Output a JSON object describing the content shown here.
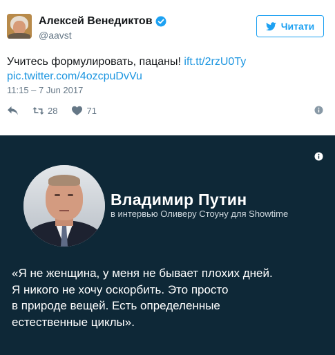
{
  "tweet": {
    "author_name": "Алексей Венедиктов",
    "handle": "@aavst",
    "follow_label": "Читати",
    "text": "Учитесь формулировать, пацаны! ",
    "link1": "ift.tt/2rzU0Ty",
    "link2": "pic.twitter.com/4ozcpuDvVu",
    "timestamp": "11:15 – 7 Jun 2017",
    "retweets": "28",
    "likes": "71"
  },
  "media": {
    "speaker_name": "Владимир Путин",
    "speaker_subtitle": "в интервью Оливеру Стоуну для Showtime",
    "quote_lines": [
      "«Я не женщина, у меня не бывает плохих дней.",
      "Я никого не хочу оскорбить. Это просто",
      "в природе вещей. Есть определенные",
      "естественные циклы»."
    ]
  },
  "colors": {
    "accent": "#1da1f2",
    "link": "#1b95e0",
    "media_bg": "#0e2837",
    "muted": "#657786"
  },
  "icons": [
    "verified-badge-icon",
    "twitter-bird-icon",
    "reply-icon",
    "retweet-icon",
    "heart-icon",
    "info-icon"
  ]
}
